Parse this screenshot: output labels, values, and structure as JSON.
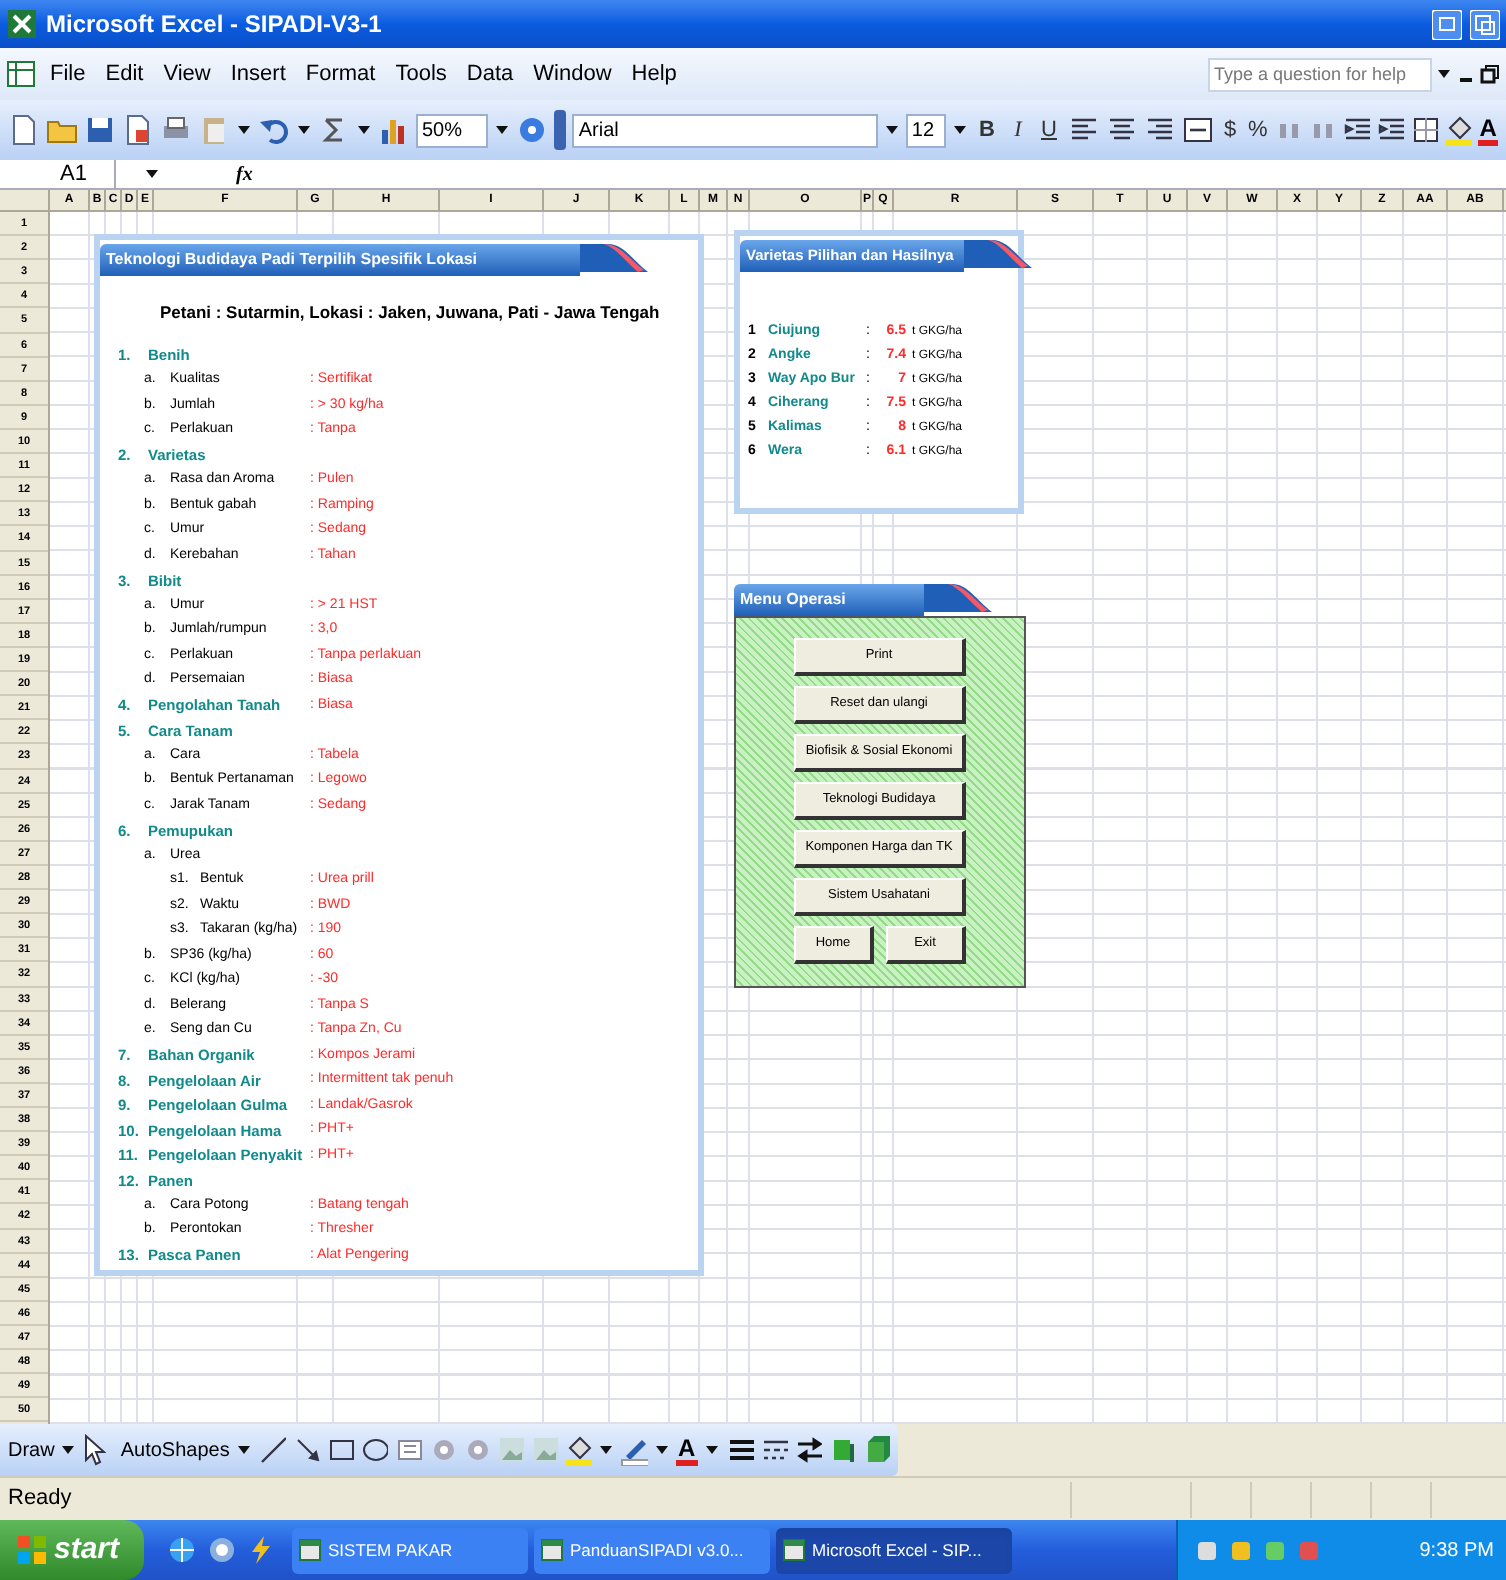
{
  "window": {
    "title": "Microsoft Excel - SIPADI-V3-1"
  },
  "menu_bar": [
    "File",
    "Edit",
    "View",
    "Insert",
    "Format",
    "Tools",
    "Data",
    "Window",
    "Help"
  ],
  "help_box": {
    "placeholder": "Type a question for help"
  },
  "toolbar": {
    "zoom": "50%",
    "font": "Arial",
    "font_size": "12",
    "format_buttons": [
      "B",
      "I",
      "U"
    ],
    "number_buttons": [
      "$",
      "%"
    ],
    "font_color": "A"
  },
  "formula_bar": {
    "name_box": "A1",
    "function_label": "fx"
  },
  "column_headers": [
    "A",
    "B",
    "C",
    "D",
    "E",
    "F",
    "G",
    "H",
    "I",
    "J",
    "K",
    "L",
    "M",
    "N",
    "O",
    "P",
    "Q",
    "R",
    "S",
    "T",
    "U",
    "V",
    "W",
    "X",
    "Y",
    "Z",
    "AA",
    "AB"
  ],
  "row_headers": [
    "1",
    "2",
    "3",
    "4",
    "5",
    "6",
    "7",
    "8",
    "9",
    "10",
    "11",
    "12",
    "13",
    "14",
    "15",
    "16",
    "17",
    "18",
    "19",
    "20",
    "21",
    "22",
    "23",
    "24",
    "25",
    "26",
    "27",
    "28",
    "29",
    "30",
    "31",
    "32",
    "33",
    "34",
    "35",
    "36",
    "37",
    "38",
    "39",
    "40",
    "41",
    "42",
    "43",
    "44",
    "45",
    "46",
    "47",
    "48",
    "49",
    "50"
  ],
  "tech_panel": {
    "title": "Teknologi Budidaya Padi Terpilih Spesifik Lokasi",
    "subtitle": "Petani : Sutarmin, Lokasi : Jaken, Juwana, Pati - Jawa Tengah",
    "sections": [
      {
        "number": "1.",
        "label": "Benih",
        "children": [
          {
            "marker": "a.",
            "label": "Kualitas",
            "value": ": Sertifikat"
          },
          {
            "marker": "b.",
            "label": "Jumlah",
            "value": ": > 30 kg/ha"
          },
          {
            "marker": "c.",
            "label": "Perlakuan",
            "value": ": Tanpa"
          }
        ]
      },
      {
        "number": "2.",
        "label": "Varietas",
        "children": [
          {
            "marker": "a.",
            "label": "Rasa dan Aroma",
            "value": ": Pulen"
          },
          {
            "marker": "b.",
            "label": "Bentuk gabah",
            "value": ": Ramping"
          },
          {
            "marker": "c.",
            "label": "Umur",
            "value": ": Sedang"
          },
          {
            "marker": "d.",
            "label": "Kerebahan",
            "value": ": Tahan"
          }
        ]
      },
      {
        "number": "3.",
        "label": "Bibit",
        "children": [
          {
            "marker": "a.",
            "label": "Umur",
            "value": ": > 21 HST"
          },
          {
            "marker": "b.",
            "label": "Jumlah/rumpun",
            "value": ": 3,0"
          },
          {
            "marker": "c.",
            "label": "Perlakuan",
            "value": ": Tanpa perlakuan"
          },
          {
            "marker": "d.",
            "label": "Persemaian",
            "value": ": Biasa"
          }
        ]
      },
      {
        "number": "4.",
        "label": "Pengolahan Tanah",
        "value": ": Biasa"
      },
      {
        "number": "5.",
        "label": "Cara Tanam",
        "children": [
          {
            "marker": "a.",
            "label": "Cara",
            "value": ": Tabela"
          },
          {
            "marker": "b.",
            "label": "Bentuk Pertanaman",
            "value": ": Legowo"
          },
          {
            "marker": "c.",
            "label": "Jarak Tanam",
            "value": ": Sedang"
          }
        ]
      },
      {
        "number": "6.",
        "label": "Pemupukan",
        "children": [
          {
            "marker": "a.",
            "label": "Urea",
            "children": [
              {
                "marker": "s1.",
                "label": "Bentuk",
                "value": ": Urea prill"
              },
              {
                "marker": "s2.",
                "label": "Waktu",
                "value": ": BWD"
              },
              {
                "marker": "s3.",
                "label": "Takaran (kg/ha)",
                "value": ": 190"
              }
            ]
          },
          {
            "marker": "b.",
            "label": "SP36 (kg/ha)",
            "value": ": 60"
          },
          {
            "marker": "c.",
            "label": "KCl (kg/ha)",
            "value": ": -30"
          },
          {
            "marker": "d.",
            "label": "Belerang",
            "value": ": Tanpa S"
          },
          {
            "marker": "e.",
            "label": "Seng dan Cu",
            "value": ": Tanpa Zn, Cu"
          }
        ]
      },
      {
        "number": "7.",
        "label": "Bahan Organik",
        "value": ": Kompos Jerami"
      },
      {
        "number": "8.",
        "label": "Pengelolaan Air",
        "value": ": Intermittent tak penuh"
      },
      {
        "number": "9.",
        "label": "Pengelolaan Gulma",
        "value": ": Landak/Gasrok"
      },
      {
        "number": "10.",
        "label": "Pengelolaan Hama",
        "value": ": PHT+"
      },
      {
        "number": "11.",
        "label": "Pengelolaan Penyakit",
        "value": ": PHT+"
      },
      {
        "number": "12.",
        "label": "Panen",
        "children": [
          {
            "marker": "a.",
            "label": "Cara Potong",
            "value": ": Batang tengah"
          },
          {
            "marker": "b.",
            "label": "Perontokan",
            "value": ": Thresher"
          }
        ]
      },
      {
        "number": "13.",
        "label": "Pasca Panen",
        "value": ": Alat Pengering"
      }
    ]
  },
  "varieties_panel": {
    "title": "Varietas Pilihan dan Hasilnya",
    "rows": [
      {
        "number": "1",
        "name": "Ciujung",
        "separator": ":",
        "yield": "6.5",
        "unit": "t GKG/ha"
      },
      {
        "number": "2",
        "name": "Angke",
        "separator": ":",
        "yield": "7.4",
        "unit": "t GKG/ha"
      },
      {
        "number": "3",
        "name": "Way Apo Bur",
        "separator": ":",
        "yield": "7",
        "unit": "t GKG/ha"
      },
      {
        "number": "4",
        "name": "Ciherang",
        "separator": ":",
        "yield": "7.5",
        "unit": "t GKG/ha"
      },
      {
        "number": "5",
        "name": "Kalimas",
        "separator": ":",
        "yield": "8",
        "unit": "t GKG/ha"
      },
      {
        "number": "6",
        "name": "Wera",
        "separator": ":",
        "yield": "6.1",
        "unit": "t GKG/ha"
      }
    ]
  },
  "menu_panel": {
    "title": "Menu Operasi",
    "buttons": [
      {
        "label": "Print",
        "kind": "wide"
      },
      {
        "label": "Reset dan ulangi",
        "kind": "wide"
      },
      {
        "label": "Biofisik & Sosial Ekonomi",
        "kind": "wide"
      },
      {
        "label": "Teknologi Budidaya",
        "kind": "wide"
      },
      {
        "label": "Komponen Harga dan TK",
        "kind": "wide"
      },
      {
        "label": "Sistem Usahatani",
        "kind": "wide"
      },
      {
        "label": "Home",
        "kind": "half"
      },
      {
        "label": "Exit",
        "kind": "half"
      }
    ]
  },
  "drawing_toolbar": {
    "draw": "Draw",
    "autoshapes": "AutoShapes",
    "font_color": "A"
  },
  "status_bar": {
    "text": "Ready"
  },
  "taskbar": {
    "start": "start",
    "tasks": [
      {
        "label": "SISTEM PAKAR",
        "selected": false
      },
      {
        "label": "PanduanSIPADI v3.0...",
        "selected": false
      },
      {
        "label": "Microsoft Excel - SIP...",
        "selected": true
      }
    ],
    "clock": "9:38 PM"
  }
}
